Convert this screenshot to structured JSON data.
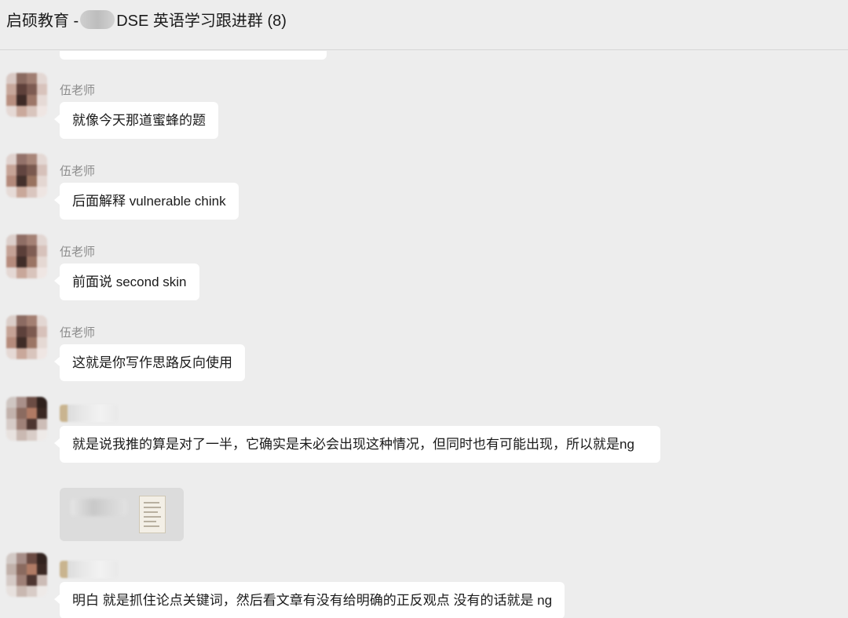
{
  "window": {
    "title_prefix": "启硕教育 -",
    "title_suffix": "DSE 英语学习跟进群 (8)"
  },
  "messages": [
    {
      "sender": "伍老师",
      "text": "就像今天那道蜜蜂的题"
    },
    {
      "sender": "伍老师",
      "text": "后面解释 vulnerable chink"
    },
    {
      "sender": "伍老师",
      "text": "前面说 second skin"
    },
    {
      "sender": "伍老师",
      "text": "这就是你写作思路反向使用"
    },
    {
      "sender": "",
      "text": "就是说我推的算是对了一半，它确实是未必会出现这种情况，但同时也有可能出现，所以就是ng"
    },
    {
      "sender": "",
      "text": "明白 就是抓住论点关键词，然后看文章有没有给明确的正反观点 没有的话就是 ng"
    }
  ],
  "colors": {
    "background": "#ededed",
    "bubble": "#ffffff",
    "sender_text": "#8c8c8c",
    "message_text": "#1a1a1a"
  },
  "icons": {
    "file_thumbnail": "document-thumbnail-icon"
  }
}
